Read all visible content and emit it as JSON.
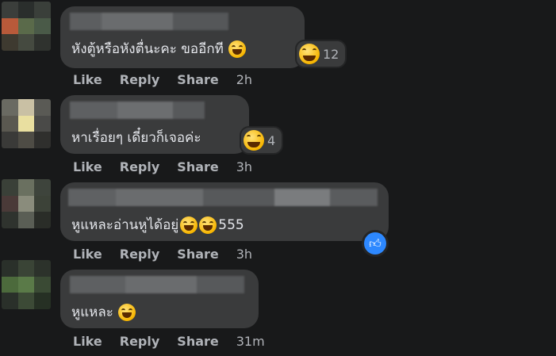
{
  "actions": {
    "like": "Like",
    "reply": "Reply",
    "share": "Share"
  },
  "comments": [
    {
      "text": "หังตู้หรือหังตื่นะคะ ขออีกที",
      "inline_emoji": "rofl-emoji",
      "reaction_emoji": "laughing-emoji",
      "reaction_count": "12",
      "time": "2h"
    },
    {
      "text": "หาเรื่อยๆ เดี๋ยวก็เจอค่ะ",
      "reaction_emoji": "laughing-emoji",
      "reaction_count": "4",
      "time": "3h"
    },
    {
      "text": "หูแหละอ่านหูได้อยู่",
      "inline_emoji": "grinning-emoji",
      "text_suffix": "555",
      "reaction_emoji": "like-thumb-icon",
      "time": "3h"
    },
    {
      "text": "หูแหละ",
      "inline_emoji": "sweat-smile-emoji",
      "time": "31m"
    }
  ],
  "colors": {
    "background": "#18191a",
    "bubble": "#3a3b3c",
    "like_blue": "#2d88ff",
    "secondary_text": "#b0b3b8"
  }
}
